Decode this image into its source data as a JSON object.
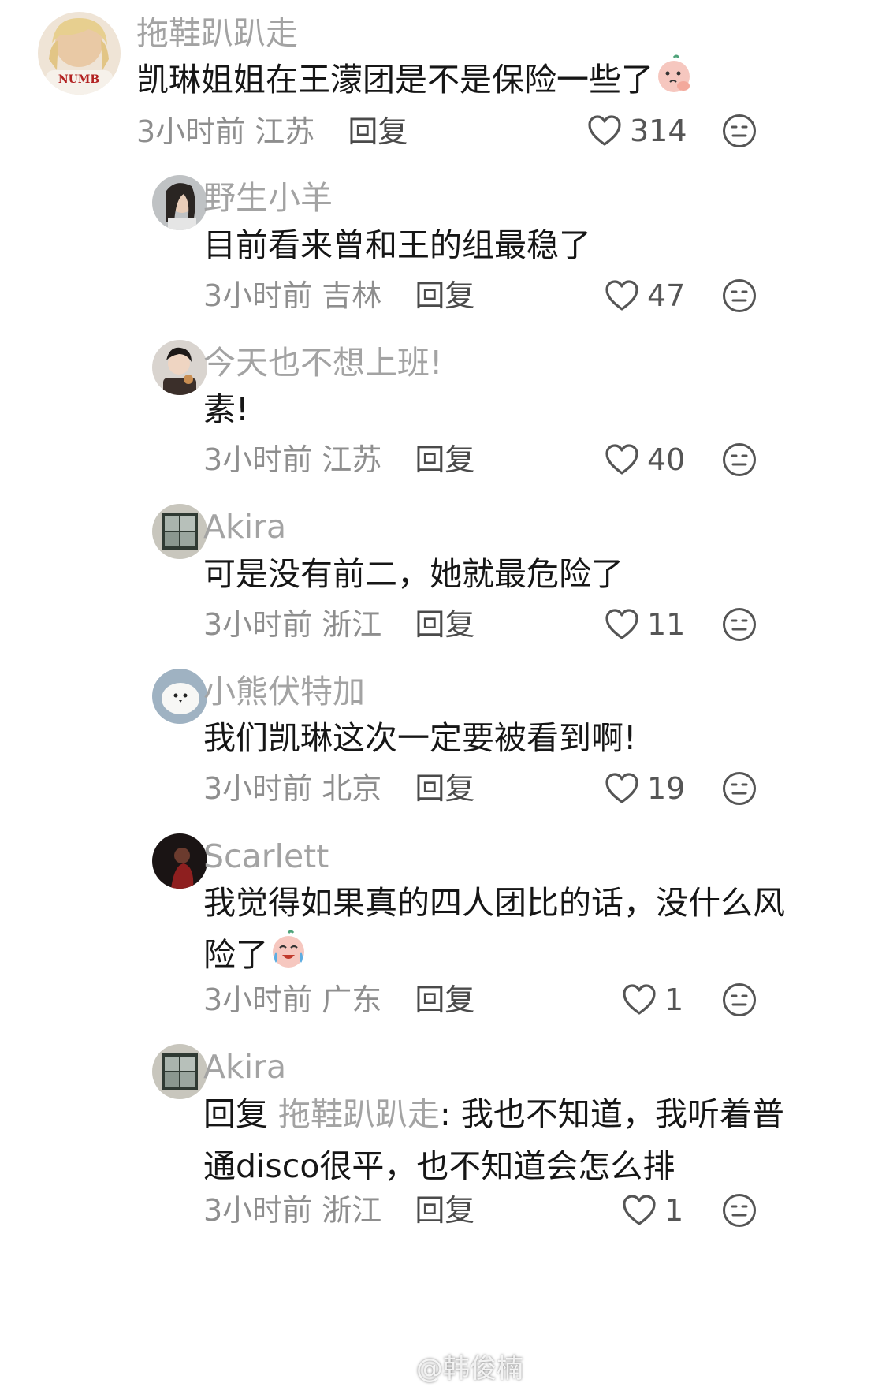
{
  "comments": [
    {
      "username": "拖鞋趴趴走",
      "text": "凯琳姐姐在王濛团是不是保险一些了",
      "emoji": "worried-face-emoji",
      "time": "3小时前",
      "location": "江苏",
      "reply_label": "回复",
      "likes": "314",
      "avatar_text": "NUMB"
    },
    {
      "username": "野生小羊",
      "text": "目前看来曾和王的组最稳了",
      "time": "3小时前",
      "location": "吉林",
      "reply_label": "回复",
      "likes": "47"
    },
    {
      "username": "今天也不想上班!",
      "text": "素!",
      "time": "3小时前",
      "location": "江苏",
      "reply_label": "回复",
      "likes": "40"
    },
    {
      "username": "Akira",
      "text": "可是没有前二，她就最危险了",
      "time": "3小时前",
      "location": "浙江",
      "reply_label": "回复",
      "likes": "11"
    },
    {
      "username": "小熊伏特加",
      "text": "我们凯琳这次一定要被看到啊!",
      "time": "3小时前",
      "location": "北京",
      "reply_label": "回复",
      "likes": "19"
    },
    {
      "username": "Scarlett",
      "text_line1": "我觉得如果真的四人团比的话，没什么风",
      "text_line2": "险了",
      "emoji": "crying-laughing-emoji",
      "time": "3小时前",
      "location": "广东",
      "reply_label": "回复",
      "likes": "1"
    },
    {
      "username": "Akira",
      "reply_prefix": "回复",
      "mention": "拖鞋趴趴走",
      "text_line1": ": 我也不知道，我听着普",
      "text_line2": "通disco很平，也不知道会怎么排",
      "time": "3小时前",
      "location": "浙江",
      "reply_label": "回复",
      "likes": "1"
    }
  ],
  "watermark": "@韩俊楠",
  "colors": {
    "username": "#a3a3a3",
    "text": "#161616",
    "meta": "#8e8e8e",
    "icon": "#555555"
  }
}
